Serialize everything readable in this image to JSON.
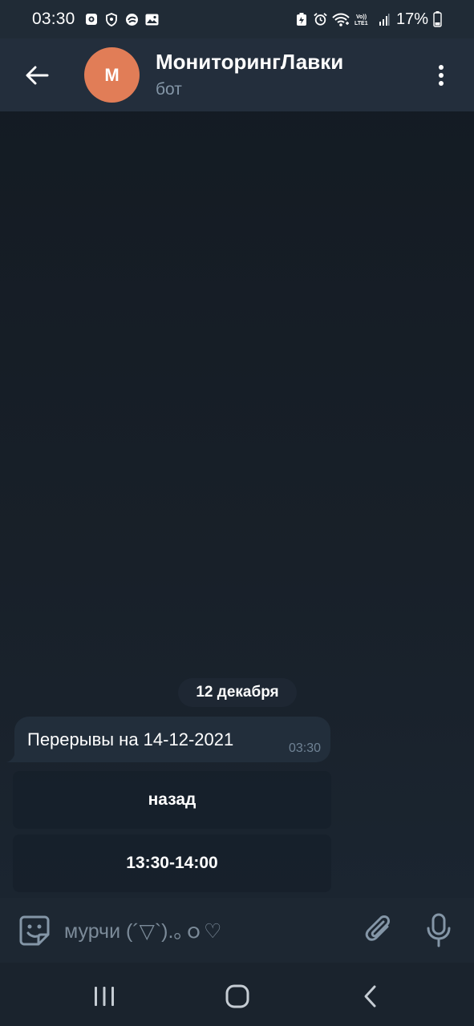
{
  "status_bar": {
    "time": "03:30",
    "battery": "17%",
    "left_icons": [
      "photo-square-icon",
      "shield-icon",
      "sync-circle-icon",
      "image-icon"
    ],
    "right_icons": [
      "battery-saver-icon",
      "alarm-icon",
      "wifi-icon",
      "volte-icon",
      "signal-icon",
      "battery-icon"
    ],
    "volte_label": "Vo)) LTE1"
  },
  "header": {
    "avatar_letter": "М",
    "avatar_color": "#e17d57",
    "title": "МониторингЛавки",
    "subtitle": "бот"
  },
  "chat": {
    "date_label": "12 декабря",
    "message": {
      "text": "Перерывы на 14-12-2021",
      "time": "03:30"
    },
    "keyboard_buttons": [
      {
        "label": "назад"
      },
      {
        "label": "13:30-14:00"
      }
    ]
  },
  "input": {
    "placeholder": "мурчи (´▽`).｡ｏ♡"
  },
  "colors": {
    "accent": "#e17d57",
    "header_bg": "#232e3c",
    "bubble_bg": "#222e3b",
    "muted_text": "#8496a7"
  }
}
